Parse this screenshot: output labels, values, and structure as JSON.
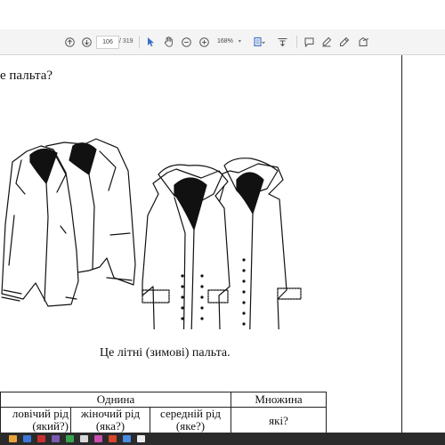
{
  "toolbar": {
    "page_current": "106",
    "page_total": "/ 319",
    "zoom": "168%",
    "zoom_caret": "▾",
    "icons": [
      "page-up-icon",
      "page-down-icon",
      "select-pointer-icon",
      "hand-icon",
      "zoom-out-icon",
      "zoom-in-icon",
      "fit-page-icon",
      "scroll-mode-icon",
      "comment-icon",
      "highlight-icon",
      "draw-icon",
      "share-icon"
    ]
  },
  "document": {
    "question": "е  пальта?",
    "caption": "Це літні (зимові) пальта.",
    "table": {
      "singular_header": "Однина",
      "plural_header": "Множина",
      "masculine": "ловічий рід (який?)",
      "feminine": "жіночий рід (яка?)",
      "neuter": "середній рід (яке?)",
      "plural_question": "які?"
    }
  },
  "taskbar": {
    "icon_colors": [
      "#e8a33b",
      "#3b78d8",
      "#cc2f2f",
      "#7a5ab0",
      "#3aa34f",
      "#d9d9d9",
      "#c94fb0",
      "#d8472b",
      "#4a8de0",
      "#ececec"
    ]
  }
}
